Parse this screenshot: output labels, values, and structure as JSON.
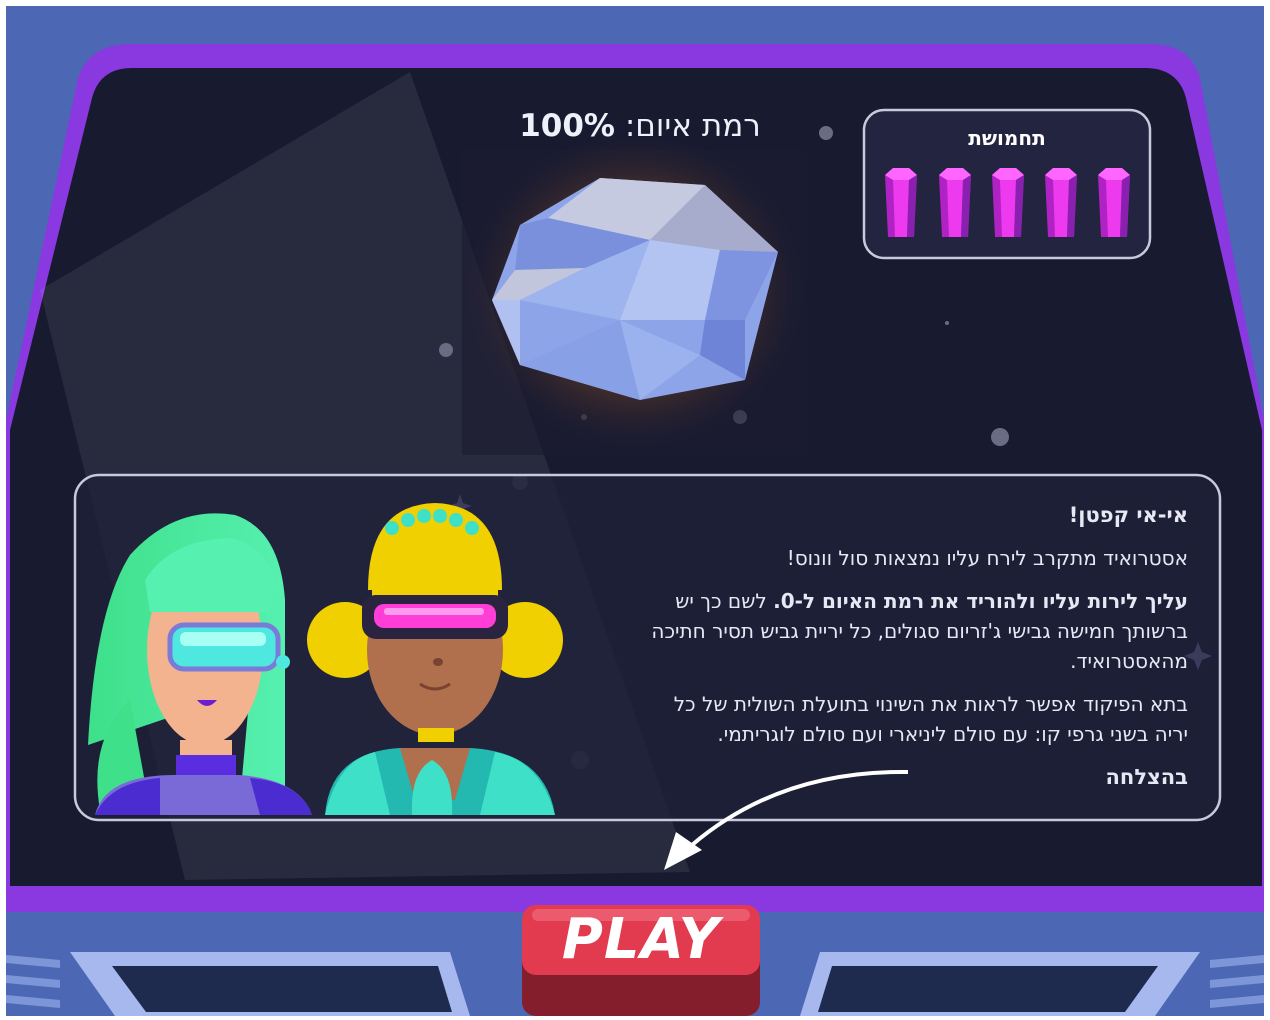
{
  "threat": {
    "label": "רמת איום:",
    "value": "100%",
    "level": 1.0
  },
  "ammo": {
    "label": "תחמושת",
    "count": 5,
    "icon": "crystal-icon"
  },
  "message": {
    "greeting": "אי-אי קפטן!",
    "line1": "אסטרואיד מתקרב לירח עליו נמצאות סול וונוס!",
    "mission_bold": "עליך לירות עליו ולהוריד את רמת האיום ל-0.",
    "mission_rest": " לשם כך יש ברשותך חמישה גבישי ג'זריום סגולים, כל יריית גביש תסיר חתיכה מהאסטרואיד.",
    "tip": "בתא הפיקוד אפשר לראות את השינוי בתועלת השולית של כל יריה בשני גרפי קו: עם סולם ליניארי ועם סולם לוגריתמי.",
    "signoff": "בהצלחה"
  },
  "play_button": {
    "label": "PLAY"
  },
  "colors": {
    "frame_purple": "#8a38e0",
    "hull_blue": "#4c68b4",
    "space_dark": "#181a30",
    "crystal_pink": "#ee3aee",
    "play_red": "#e23a4f",
    "play_dark": "#841d2c",
    "visor_cyan": "#4ee8e0",
    "visor_pink": "#ff3ed8"
  }
}
